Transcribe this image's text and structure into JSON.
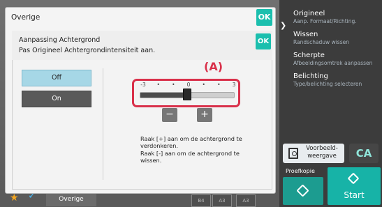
{
  "outer_dialog": {
    "title": "Overige",
    "ok_label": "OK"
  },
  "inner_dialog": {
    "title": "Aanpassing Achtergrond",
    "subtitle": "Pas Origineel Achtergrondintensiteit aan.",
    "ok_label": "OK"
  },
  "toggle": {
    "off_label": "Off",
    "on_label": "On",
    "selected": "Off"
  },
  "slider": {
    "tick_labels": [
      "-3",
      "•",
      "•",
      "0",
      "•",
      "•",
      "3"
    ],
    "min": -3,
    "max": 3,
    "value": 0
  },
  "callout_label": "(A)",
  "buttons": {
    "minus_label": "−",
    "plus_label": "+"
  },
  "help_lines": [
    "Raak [+] aan om de achtergrond te",
    "verdonkeren.",
    "Raak [-] aan om de achtergrond te",
    "wissen."
  ],
  "right_menu": [
    {
      "title": "Origineel",
      "sub": "Aanp. Formaat/Richting."
    },
    {
      "title": "Wissen",
      "sub": "Randschaduw wissen"
    },
    {
      "title": "Scherpte",
      "sub": "Afbeeldingsomtrek aanpassen"
    },
    {
      "title": "Belichting",
      "sub": "Type/belichting selecteren"
    }
  ],
  "preview_label": "Voorbeeld-\nweergave",
  "ca_label": "CA",
  "proefkopie_label": "Proefkopie",
  "start_label": "Start",
  "bottom_bar": {
    "label": "Overige",
    "trays": [
      "B4",
      "A3",
      "A3"
    ]
  },
  "colors": {
    "accent": "#1bbfae",
    "highlight": "#d9304a",
    "start": "#17b3a7",
    "off_selected": "#a6d7e6"
  }
}
